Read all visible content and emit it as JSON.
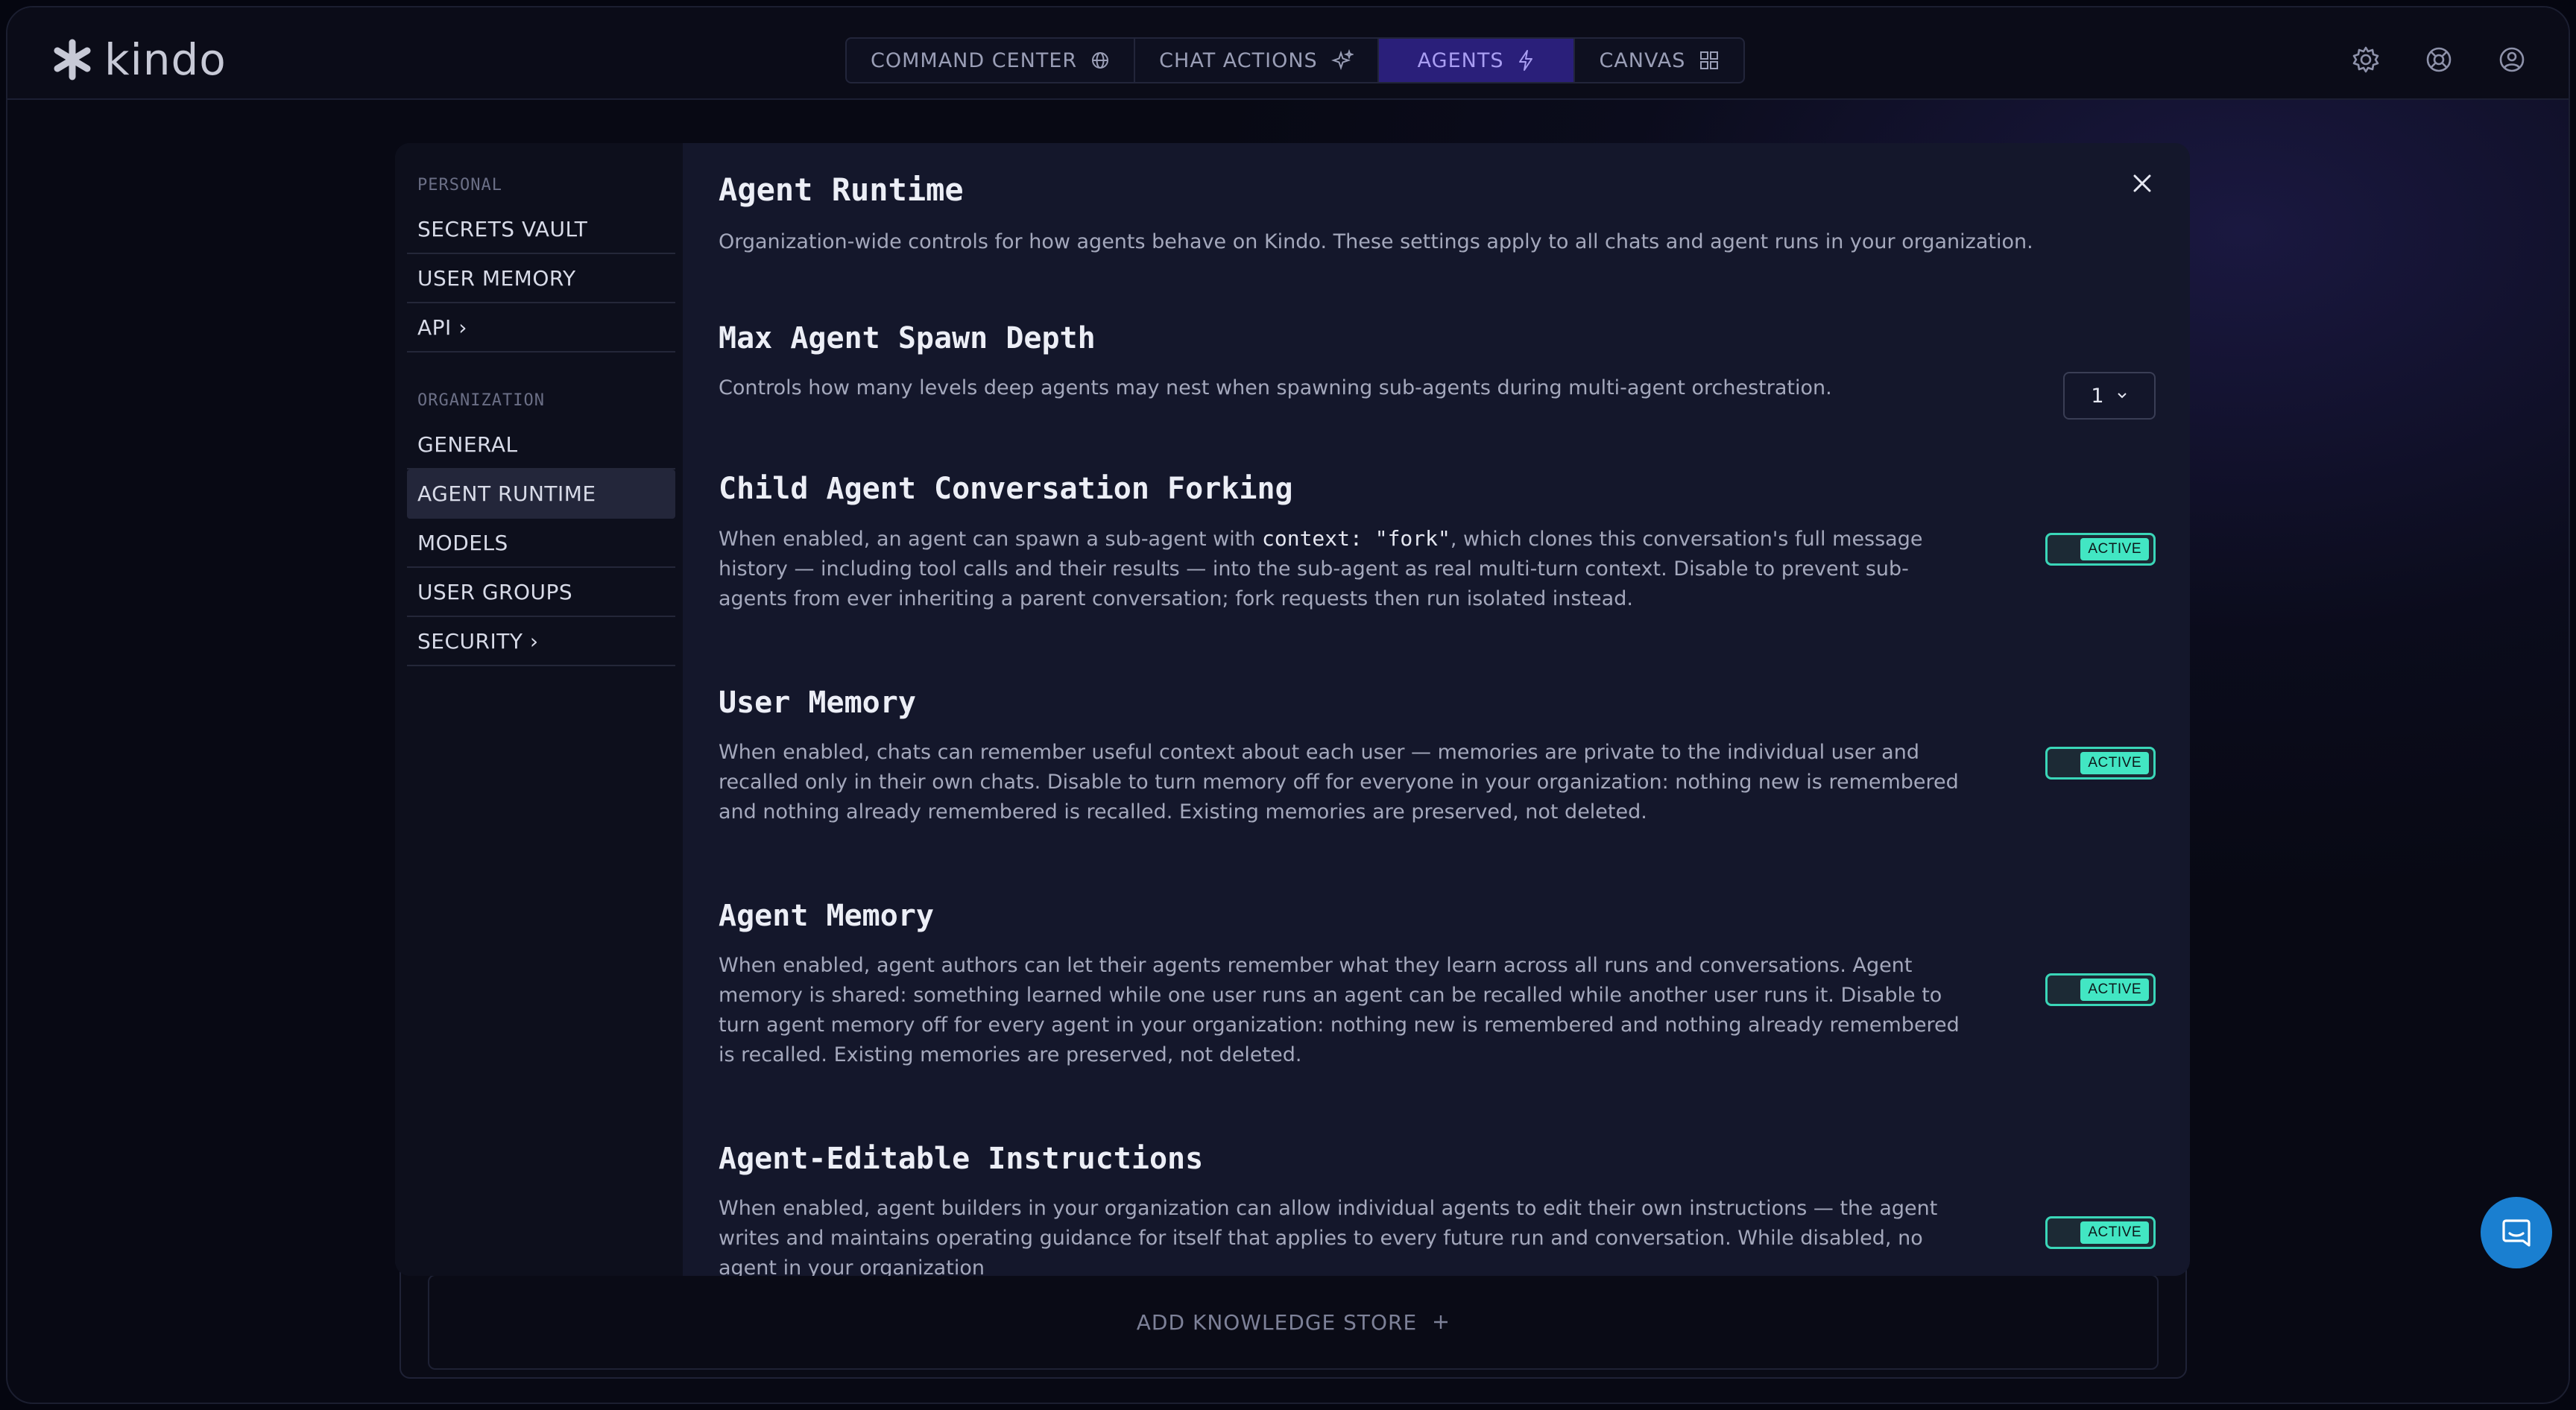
{
  "app": {
    "logo_text": "kindo"
  },
  "nav": {
    "items": [
      {
        "label": "COMMAND CENTER",
        "icon": "globe-icon"
      },
      {
        "label": "CHAT ACTIONS",
        "icon": "sparkle-icon"
      },
      {
        "label": "AGENTS",
        "icon": "bolt-icon",
        "active": true
      },
      {
        "label": "CANVAS",
        "icon": "grid-icon"
      }
    ]
  },
  "top_icons": [
    "settings-icon",
    "help-ring-icon",
    "user-icon"
  ],
  "background": {
    "add_knowledge_store": "ADD KNOWLEDGE STORE"
  },
  "sidebar": {
    "personal_title": "PERSONAL",
    "personal_items": [
      {
        "label": "SECRETS VAULT"
      },
      {
        "label": "USER MEMORY"
      },
      {
        "label": "API ›"
      }
    ],
    "org_title": "ORGANIZATION",
    "org_items": [
      {
        "label": "GENERAL"
      },
      {
        "label": "AGENT RUNTIME",
        "active": true
      },
      {
        "label": "MODELS"
      },
      {
        "label": "USER GROUPS"
      },
      {
        "label": "SECURITY ›"
      }
    ]
  },
  "content": {
    "title": "Agent Runtime",
    "description": "Organization-wide controls for how agents behave on Kindo. These settings apply to all chats and agent runs in your organization.",
    "settings": [
      {
        "title": "Max Agent Spawn Depth",
        "description": "Controls how many levels deep agents may nest when spawning sub-agents during multi-agent orchestration.",
        "control": "select",
        "value": "1"
      },
      {
        "title": "Child Agent Conversation Forking",
        "description_pre": "When enabled, an agent can spawn a sub-agent with ",
        "description_code": "context: \"fork\"",
        "description_post": ", which clones this conversation's full message history — including tool calls and their results — into the sub-agent as real multi-turn context. Disable to prevent sub-agents from ever inheriting a parent conversation; fork requests then run isolated instead.",
        "control": "toggle",
        "state": "ACTIVE"
      },
      {
        "title": "User Memory",
        "description": "When enabled, chats can remember useful context about each user — memories are private to the individual user and recalled only in their own chats. Disable to turn memory off for everyone in your organization: nothing new is remembered and nothing already remembered is recalled. Existing memories are preserved, not deleted.",
        "control": "toggle",
        "state": "ACTIVE"
      },
      {
        "title": "Agent Memory",
        "description": "When enabled, agent authors can let their agents remember what they learn across all runs and conversations. Agent memory is shared: something learned while one user runs an agent can be recalled while another user runs it. Disable to turn agent memory off for every agent in your organization: nothing new is remembered and nothing already remembered is recalled. Existing memories are preserved, not deleted.",
        "control": "toggle",
        "state": "ACTIVE"
      },
      {
        "title": "Agent-Editable Instructions",
        "description": "When enabled, agent builders in your organization can allow individual agents to edit their own instructions — the agent writes and maintains operating guidance for itself that applies to every future run and conversation. While disabled, no agent in your organization",
        "control": "toggle",
        "state": "ACTIVE"
      }
    ]
  },
  "colors": {
    "accent_toggle": "#42e6c3",
    "nav_active": "#2a1f7a",
    "help_button": "#1a7fd0"
  }
}
